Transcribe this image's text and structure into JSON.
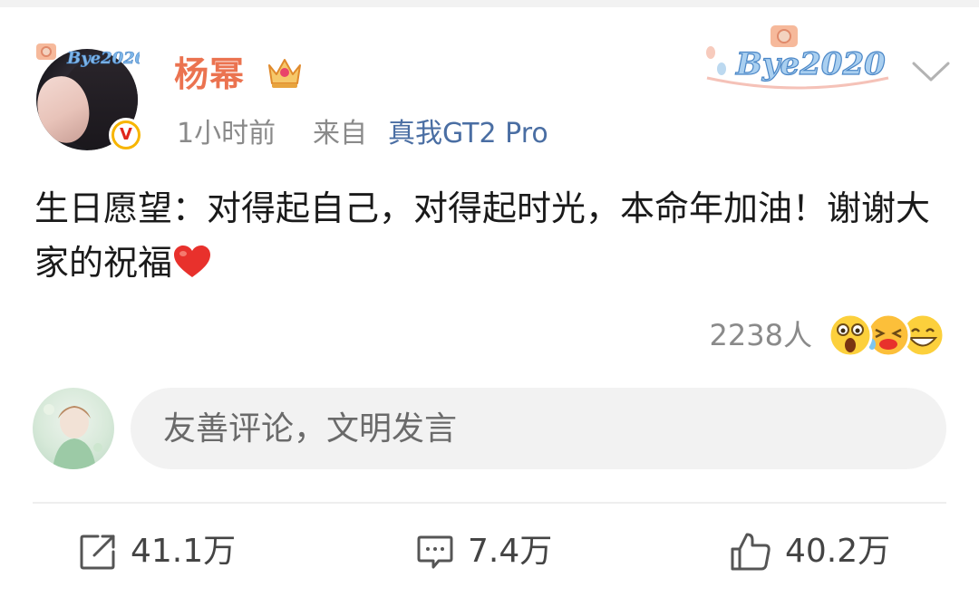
{
  "post": {
    "author": {
      "name": "杨幂",
      "verified": true,
      "verified_mark": "V",
      "badge_icon": "crown-icon",
      "avatar_decoration": "Bye2020"
    },
    "meta": {
      "time": "1小时前",
      "source_prefix": "来自",
      "source_device": "真我GT2 Pro"
    },
    "decoration_badge_text": "Bye2020",
    "text": "生日愿望：对得起自己，对得起时光，本命年加油！谢谢大家的祝福",
    "text_trailing_icon": "heart-icon",
    "reactions": {
      "count_label": "2238人",
      "emojis": [
        "surprised-emoji",
        "laugh-cry-emoji",
        "grin-emoji"
      ]
    }
  },
  "comment_box": {
    "placeholder": "友善评论，文明发言"
  },
  "actions": {
    "repost": "41.1万",
    "comment": "7.4万",
    "like": "40.2万"
  },
  "colors": {
    "username": "#eb7350",
    "link": "#4a6ea3",
    "meta": "#8a8a8a",
    "verified": "#f7b500"
  }
}
